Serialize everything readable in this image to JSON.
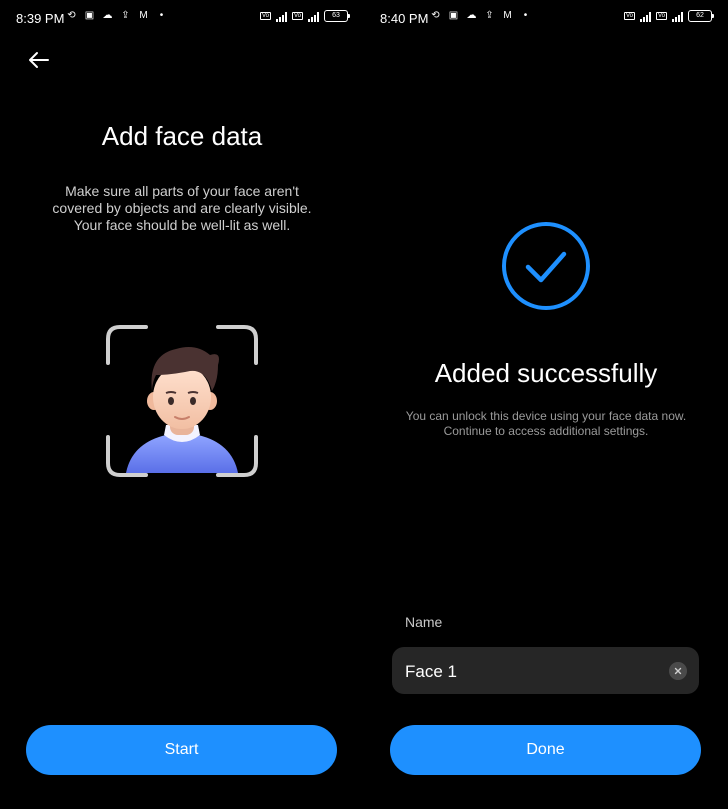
{
  "colors": {
    "accent": "#1e90ff",
    "background": "#000000",
    "field_bg": "#262626"
  },
  "left": {
    "status": {
      "time": "8:39 PM",
      "battery": "63"
    },
    "title": "Add face data",
    "description_lines": [
      "Make sure all parts of your face aren't",
      "covered by objects and are clearly visible.",
      "Your face should be well-lit as well."
    ],
    "start_label": "Start"
  },
  "right": {
    "status": {
      "time": "8:40 PM",
      "battery": "62"
    },
    "title": "Added successfully",
    "description_lines": [
      "You can unlock this device using your face data now.",
      "Continue to access additional settings."
    ],
    "name_label": "Name",
    "name_value": "Face 1",
    "done_label": "Done"
  },
  "icons": {
    "back": "back-arrow-icon",
    "success": "check-circle-icon",
    "clear": "clear-icon",
    "face": "face-avatar-illustration"
  }
}
